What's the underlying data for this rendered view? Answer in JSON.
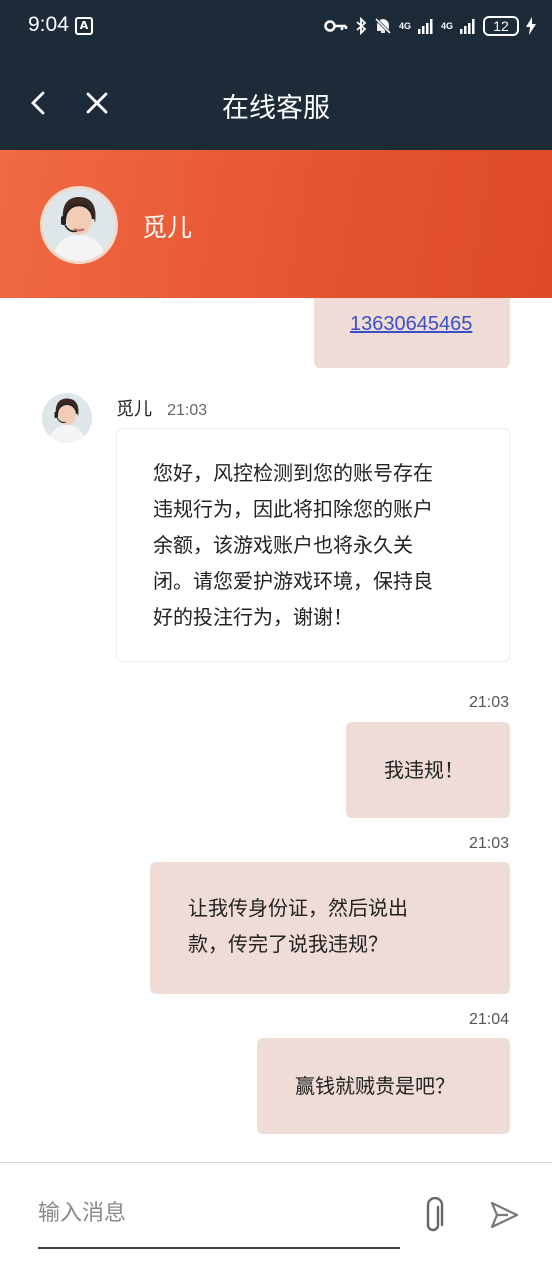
{
  "status_bar": {
    "time": "9:04",
    "app_icon_letter": "A",
    "signal1_label": "4G",
    "signal2_label": "4G",
    "battery": "12"
  },
  "header": {
    "title": "在线客服"
  },
  "agent": {
    "name": "觅儿"
  },
  "messages": {
    "m0_link": "13630645465",
    "m1_sender": "觅儿",
    "m1_time": "21:03",
    "m1_lines": [
      "您好，风控检测到您的账号存在",
      "违规行为，因此将扣除您的账户",
      "余额，该游戏账户也将永久关",
      "闭。请您爱护游戏环境，保持良",
      "好的投注行为，谢谢！"
    ],
    "m2_time": "21:03",
    "m2_text": "我违规！",
    "m3_time": "21:03",
    "m3_lines": [
      "让我传身份证，然后说出",
      "款，传完了说我违规？"
    ],
    "m4_time": "21:04",
    "m4_text": "赢钱就贼贵是吧？"
  },
  "input": {
    "placeholder": "输入消息"
  },
  "colors": {
    "topbar": "#1d2a38",
    "accent": "#e5532f",
    "bubble_self": "#efdcd6",
    "link": "#3b4fc4"
  }
}
